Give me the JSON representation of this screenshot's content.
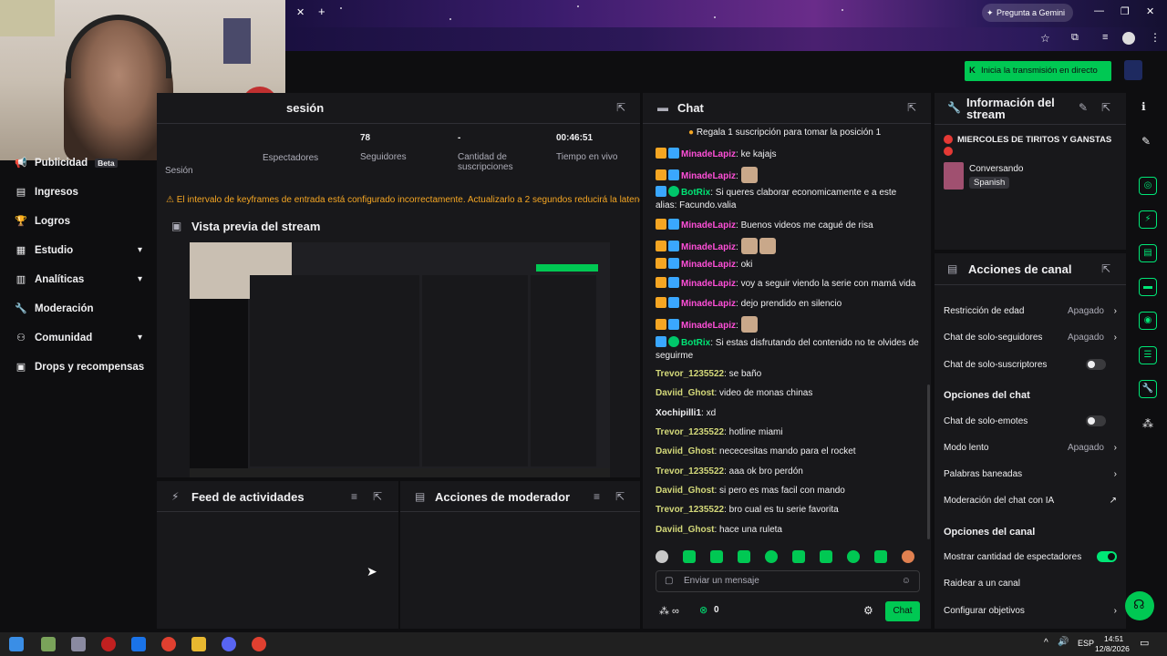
{
  "browser": {
    "gemini_label": "Pregunta a Gemini",
    "go_live_label": "Inicia la transmisión en directo"
  },
  "stats": {
    "title": "sesión",
    "items": [
      {
        "value": "",
        "label": "Sesión"
      },
      {
        "value": "",
        "label": "Espectadores"
      },
      {
        "value": "78",
        "label": "Seguidores"
      },
      {
        "value": "-",
        "label": "Cantidad de suscripciones"
      },
      {
        "value": "00:46:51",
        "label": "Tiempo en vivo"
      }
    ],
    "warning": "El intervalo de keyframes de entrada está configurado incorrectamente. Actualizarlo a 2 segundos reducirá la latencia para los espectadores."
  },
  "nav": {
    "publicidad": "Publicidad",
    "beta": "Beta",
    "items": [
      "Ingresos",
      "Logros",
      "Estudio",
      "Analíticas",
      "Moderación",
      "Comunidad",
      "Drops y recompensas"
    ]
  },
  "preview": {
    "title": "Vista previa del stream"
  },
  "feed": {
    "title": "Feed de actividades"
  },
  "mod_actions": {
    "title": "Acciones de moderador"
  },
  "chat": {
    "title": "Chat",
    "banner": "Regala 1 suscripción para tomar la posición 1",
    "messages": [
      {
        "user": "MinadeLapiz",
        "text": "ke kajajs",
        "color": "#ff4fd8"
      },
      {
        "user": "MinadeLapiz",
        "text": "",
        "color": "#ff4fd8"
      },
      {
        "user": "BotRix",
        "text": "Si queres claborar economicamente e a este alias: Facundo.valia",
        "color": "#00e676"
      },
      {
        "user": "MinadeLapiz",
        "text": "Buenos videos me cagué de risa",
        "color": "#ff4fd8"
      },
      {
        "user": "MinadeLapiz",
        "text": "",
        "color": "#ff4fd8"
      },
      {
        "user": "MinadeLapiz",
        "text": "oki",
        "color": "#ff4fd8"
      },
      {
        "user": "MinadeLapiz",
        "text": "voy a seguir viendo la serie con mamá vida",
        "color": "#ff4fd8"
      },
      {
        "user": "MinadeLapiz",
        "text": "dejo prendido en silencio",
        "color": "#ff4fd8"
      },
      {
        "user": "MinadeLapiz",
        "text": "",
        "color": "#ff4fd8"
      },
      {
        "user": "BotRix",
        "text": "Si estas disfrutando del contenido no te olvides de seguirme",
        "color": "#00e676"
      },
      {
        "user": "Trevor_1235522",
        "text": "se baño",
        "color": "#d4d97a"
      },
      {
        "user": "Daviid_Ghost",
        "text": "video de monas chinas",
        "color": "#d4d97a"
      },
      {
        "user": "Xochipilli1",
        "text": "xd",
        "color": "#efeff1"
      },
      {
        "user": "Trevor_1235522",
        "text": "hotline miami",
        "color": "#d4d97a"
      },
      {
        "user": "Daviid_Ghost",
        "text": "nececesitas mando para el rocket",
        "color": "#d4d97a"
      },
      {
        "user": "Trevor_1235522",
        "text": "aaa ok bro perdón",
        "color": "#d4d97a"
      },
      {
        "user": "Daviid_Ghost",
        "text": "si pero es mas facil con mando",
        "color": "#d4d97a"
      },
      {
        "user": "Trevor_1235522",
        "text": "bro cual es tu serie favorita",
        "color": "#d4d97a"
      },
      {
        "user": "Daviid_Ghost",
        "text": "hace una ruleta",
        "color": "#d4d97a"
      }
    ],
    "input_placeholder": "Enviar un mensaje",
    "points": "0",
    "send_label": "Chat"
  },
  "info": {
    "title": "Información del stream",
    "stream_title": "MIERCOLES DE TIRITOS Y GANSTAS",
    "category": "Conversando",
    "language": "Spanish"
  },
  "channel_actions": {
    "title": "Acciones de canal",
    "rows1": [
      {
        "label": "Restricción de edad",
        "value": "Apagado"
      },
      {
        "label": "Chat de solo-seguidores",
        "value": "Apagado"
      },
      {
        "label": "Chat de solo-suscriptores",
        "value": ""
      }
    ],
    "chat_options_title": "Opciones del chat",
    "rows2": [
      {
        "label": "Chat de solo-emotes",
        "value": ""
      },
      {
        "label": "Modo lento",
        "value": "Apagado"
      },
      {
        "label": "Palabras baneadas",
        "value": ""
      },
      {
        "label": "Moderación del chat con IA",
        "value": ""
      }
    ],
    "channel_options_title": "Opciones del canal",
    "rows3": [
      {
        "label": "Mostrar cantidad de espectadores",
        "value": ""
      },
      {
        "label": "Raidear a un canal",
        "value": ""
      },
      {
        "label": "Configurar objetivos",
        "value": ""
      }
    ]
  },
  "taskbar": {
    "lang": "ESP",
    "time": "14:51",
    "date": "12/8/2026"
  }
}
